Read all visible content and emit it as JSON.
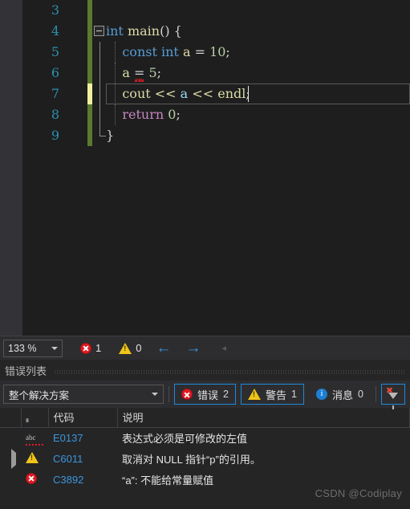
{
  "editor": {
    "language": "cpp",
    "current_line": 7,
    "lines": [
      {
        "num": "3",
        "change": "green",
        "indent": 0,
        "text": "",
        "tokens": []
      },
      {
        "num": "4",
        "change": "green",
        "indent": 0,
        "fold": true,
        "tokens": [
          {
            "t": "int",
            "c": "t-key"
          },
          {
            "t": " ",
            "c": "t-plain"
          },
          {
            "t": "main",
            "c": "t-fn"
          },
          {
            "t": "()",
            "c": "t-punct"
          },
          {
            "t": " ",
            "c": "t-plain"
          },
          {
            "t": "{",
            "c": "t-punct"
          }
        ]
      },
      {
        "num": "5",
        "change": "green",
        "indent": 1,
        "tokens": [
          {
            "t": "    ",
            "c": "t-plain"
          },
          {
            "t": "const",
            "c": "t-key"
          },
          {
            "t": " ",
            "c": "t-plain"
          },
          {
            "t": "int",
            "c": "t-key"
          },
          {
            "t": " ",
            "c": "t-plain"
          },
          {
            "t": "a",
            "c": "t-fn"
          },
          {
            "t": " = ",
            "c": "t-op"
          },
          {
            "t": "10",
            "c": "t-num"
          },
          {
            "t": ";",
            "c": "t-punct"
          }
        ]
      },
      {
        "num": "6",
        "change": "green",
        "indent": 1,
        "squiggle": true,
        "tokens": [
          {
            "t": "    ",
            "c": "t-plain"
          },
          {
            "t": "a",
            "c": "t-fn"
          },
          {
            "t": " = ",
            "c": "t-op"
          },
          {
            "t": "5",
            "c": "t-num"
          },
          {
            "t": ";",
            "c": "t-punct"
          }
        ]
      },
      {
        "num": "7",
        "change": "yellow",
        "indent": 1,
        "current": true,
        "caret": true,
        "tokens": [
          {
            "t": "    ",
            "c": "t-plain"
          },
          {
            "t": "cout",
            "c": "t-fn"
          },
          {
            "t": " ",
            "c": "t-plain"
          },
          {
            "t": "<<",
            "c": "t-fn"
          },
          {
            "t": " ",
            "c": "t-plain"
          },
          {
            "t": "a",
            "c": "t-var"
          },
          {
            "t": " ",
            "c": "t-plain"
          },
          {
            "t": "<<",
            "c": "t-fn"
          },
          {
            "t": " ",
            "c": "t-plain"
          },
          {
            "t": "endl",
            "c": "t-fn"
          },
          {
            "t": ";",
            "c": "t-punct"
          }
        ]
      },
      {
        "num": "8",
        "change": "green",
        "indent": 1,
        "tokens": [
          {
            "t": "    ",
            "c": "t-plain"
          },
          {
            "t": "return",
            "c": "t-ctrl"
          },
          {
            "t": " ",
            "c": "t-plain"
          },
          {
            "t": "0",
            "c": "t-num"
          },
          {
            "t": ";",
            "c": "t-punct"
          }
        ]
      },
      {
        "num": "9",
        "change": "green",
        "indent": 0,
        "brace_end": true,
        "tokens": [
          {
            "t": "}",
            "c": "t-punct"
          }
        ]
      }
    ]
  },
  "statusbar": {
    "zoom_level": "133 %",
    "error_icon": "error-circle-icon",
    "error_count": "1",
    "warning_icon": "warning-triangle-icon",
    "warning_count": "0",
    "nav_back_icon": "arrow-left-icon",
    "nav_back_glyph": "←",
    "nav_forward_icon": "arrow-right-icon",
    "nav_forward_glyph": "→",
    "collapse_glyph": "◂"
  },
  "panel": {
    "title": "错误列表",
    "toolbar": {
      "scope_value": "整个解决方案",
      "errors_label": "错误",
      "errors_count": "2",
      "warnings_label": "警告",
      "warnings_count": "1",
      "messages_label": "消息",
      "messages_count": "0",
      "filter_icon": "clear-filter-icon"
    },
    "table": {
      "headers": {
        "expander": "",
        "icon": "",
        "code": "代码",
        "description": "说明"
      },
      "rows": [
        {
          "expandable": false,
          "icon": "intellisense-abc-icon",
          "severity": "intellisense",
          "code": "E0137",
          "description": "表达式必须是可修改的左值"
        },
        {
          "expandable": true,
          "icon": "warning-triangle-icon",
          "severity": "warning",
          "code": "C6011",
          "description": "取消对 NULL 指针“p”的引用。"
        },
        {
          "expandable": false,
          "icon": "error-circle-icon",
          "severity": "error",
          "code": "C3892",
          "description": "“a”: 不能给常量赋值"
        }
      ]
    }
  },
  "watermark": {
    "text": "CSDN @Codiplay"
  },
  "colors": {
    "editor_bg": "#1e1e1e",
    "panel_bg": "#252526",
    "toolbar_bg": "#2d2d30",
    "linenum": "#2b91af",
    "accent_blue": "#3a96dd",
    "error_red": "#e01b24",
    "warning_yellow": "#f0c419",
    "info_blue": "#1d7fd4",
    "change_green": "#5a7a2e",
    "change_yellow": "#f0f0a0"
  }
}
